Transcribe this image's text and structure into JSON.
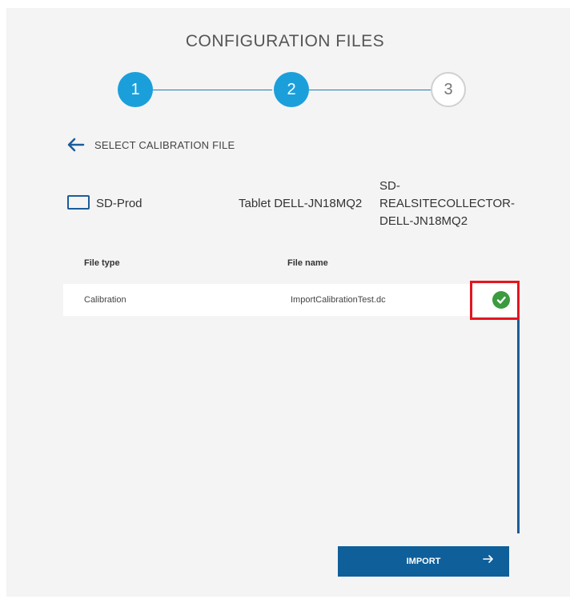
{
  "page": {
    "title": "CONFIGURATION FILES"
  },
  "stepper": {
    "steps": [
      "1",
      "2",
      "3"
    ],
    "active_steps": 2
  },
  "back": {
    "label": "SELECT CALIBRATION FILE"
  },
  "device": {
    "name": "SD-Prod",
    "tablet": "Tablet DELL-JN18MQ2",
    "collector_lines": [
      "SD-",
      "REALSITECOLLECTOR-",
      "DELL-JN18MQ2"
    ]
  },
  "table": {
    "headers": {
      "file_type": "File type",
      "file_name": "File name"
    },
    "rows": [
      {
        "file_type": "Calibration",
        "file_name": "ImportCalibrationTest.dc",
        "status": "success"
      }
    ]
  },
  "actions": {
    "import_label": "IMPORT"
  },
  "colors": {
    "accent": "#1b9fdb",
    "primary_button": "#0f5f9a",
    "success": "#3b9b3f",
    "highlight": "#e4151f"
  },
  "icons": {
    "back": "arrow-left-icon",
    "device": "tablet-icon",
    "status": "check-circle-icon",
    "import": "arrow-right-icon"
  }
}
